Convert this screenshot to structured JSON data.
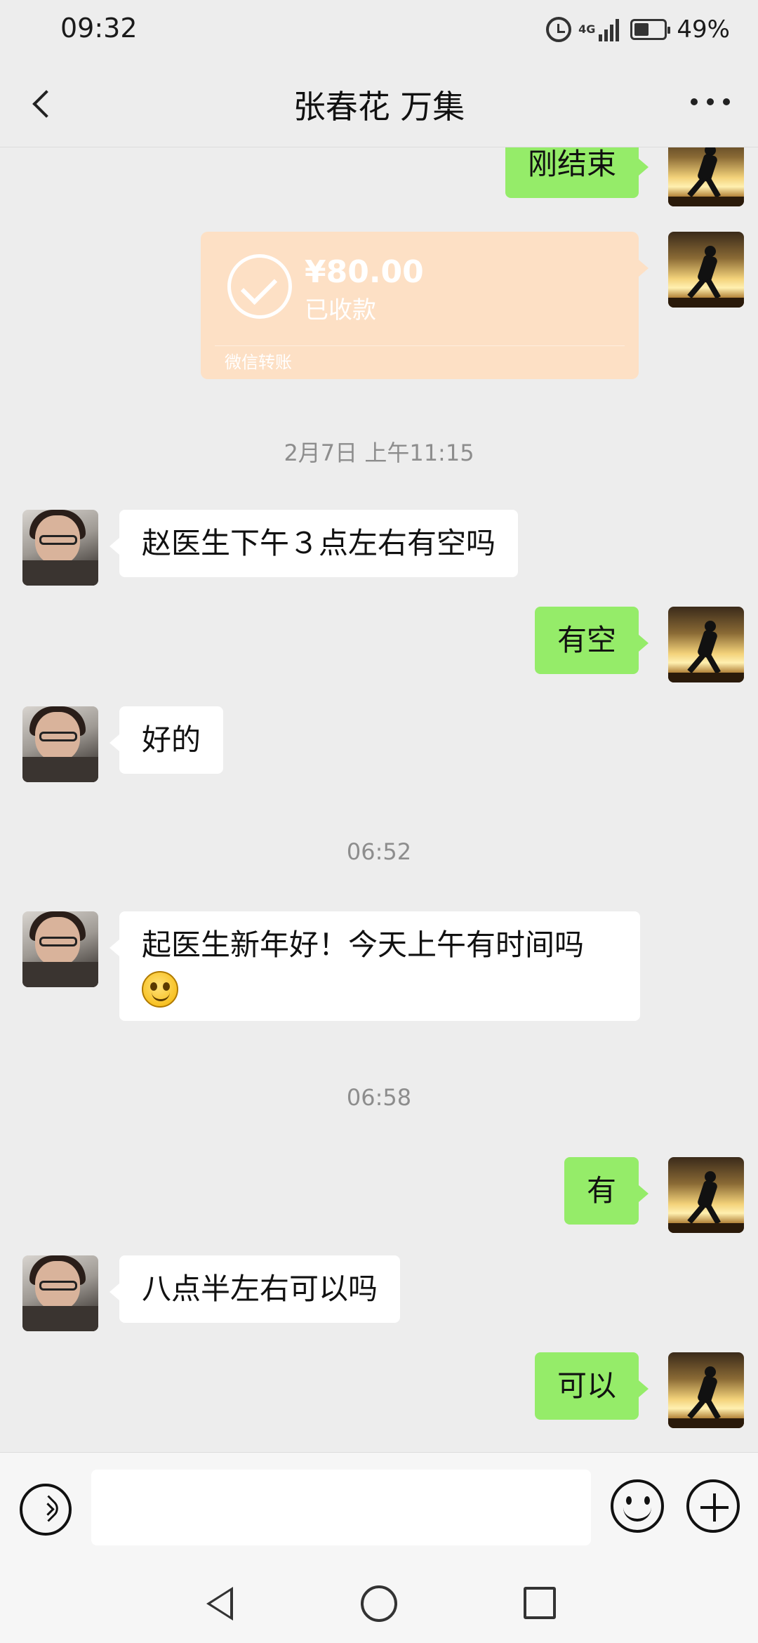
{
  "status_bar": {
    "time": "09:32",
    "network": "4G",
    "battery_percent": "49%",
    "battery_level": 0.49
  },
  "header": {
    "title": "张春花 万集"
  },
  "messages": {
    "m1": "刚结束",
    "transfer": {
      "amount": "¥80.00",
      "status": "已收款",
      "label": "微信转账"
    },
    "ts1": "2月7日 上午11:15",
    "m2": "赵医生下午３点左右有空吗",
    "m3": "有空",
    "m4": "好的",
    "ts2": "06:52",
    "m5": "起医生新年好！今天上午有时间吗",
    "ts3": "06:58",
    "m6": "有",
    "m7": "八点半左右可以吗",
    "m8": "可以"
  },
  "input": {
    "placeholder": ""
  },
  "colors": {
    "my_bubble": "#95ec69",
    "other_bubble": "#ffffff",
    "transfer_card": "#fde0c5",
    "background": "#ededed"
  },
  "icons": {
    "back": "chevron-left-icon",
    "more": "more-dots-icon",
    "voice": "voice-icon",
    "emoji": "emoji-icon",
    "plus": "plus-icon"
  }
}
